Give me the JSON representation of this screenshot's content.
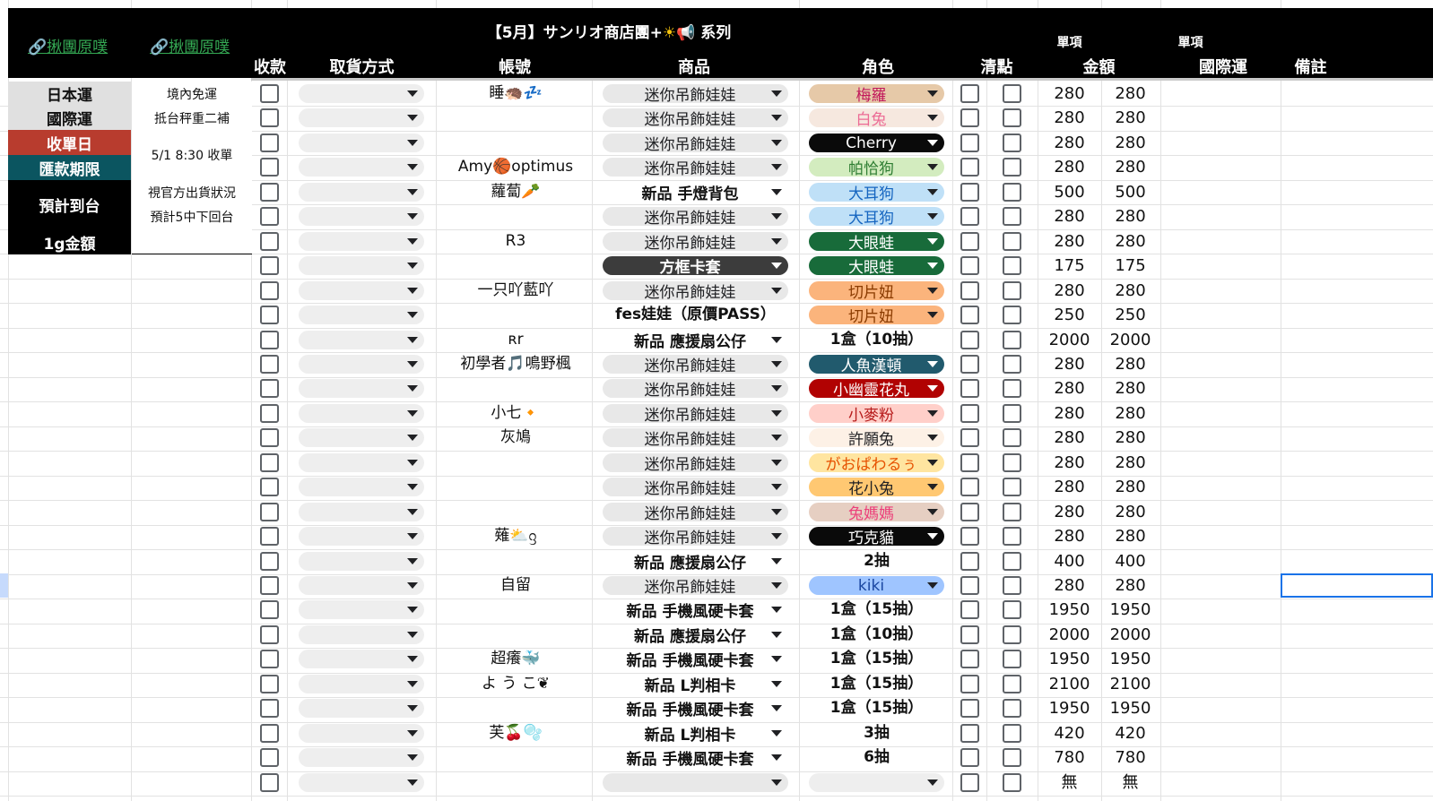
{
  "header": {
    "link1": "🔗揪團原噗",
    "link2": "🔗揪團原噗",
    "title": {
      "text1": "【5月】サンリオ商店團+",
      "sun": "☀",
      "horn": "📢",
      "text2": "系列"
    },
    "sub_single1": "單項",
    "sub_single2": "單項",
    "col_payment": "收款",
    "col_pickup": "取貨方式",
    "col_account": "帳號",
    "col_product": "商品",
    "col_role": "角色",
    "col_check": "清點",
    "col_amount": "金額",
    "col_intl": "國際運",
    "col_note": "備註"
  },
  "info": {
    "japan_ship": {
      "label": "日本運",
      "value": "境內免運"
    },
    "intl_ship": {
      "label": "國際運",
      "value": "抵台秤重二補"
    },
    "close_date": {
      "label": "收單日",
      "value": "5/1 8:30 收單"
    },
    "pay_deadline": {
      "label": "匯款期限"
    },
    "eta": {
      "label": "預計到台",
      "value1": "視官方出貨狀況",
      "value2": "預計5中下回台"
    },
    "per_gram": {
      "label": "1g金額",
      "value": ""
    }
  },
  "colors": {
    "header_bg": "#000000",
    "link": "#34a853",
    "close_date_bg": "#b83c2e",
    "deadline_bg": "#0b5560",
    "selection": "#1a73e8"
  },
  "rows": [
    {
      "account": "睡🦔💤",
      "product": "迷你吊飾娃娃",
      "pstyle": "gray",
      "role": "梅羅",
      "rbg": "#e6c9a8",
      "rfg": "#c2185b",
      "amount": "280",
      "intl": "280"
    },
    {
      "account": "",
      "product": "迷你吊飾娃娃",
      "pstyle": "gray",
      "role": "白兔",
      "rbg": "#f6e8df",
      "rfg": "#ec6b95",
      "amount": "280",
      "intl": "280"
    },
    {
      "account": "",
      "product": "迷你吊飾娃娃",
      "pstyle": "gray",
      "role": "Cherry",
      "rbg": "#0a0a0a",
      "rfg": "#ffffff",
      "amount": "280",
      "intl": "280"
    },
    {
      "account": "Amy🏀optimus",
      "product": "迷你吊飾娃娃",
      "pstyle": "gray",
      "role": "帕恰狗",
      "rbg": "#d3ecbf",
      "rfg": "#2e7d32",
      "amount": "280",
      "intl": "280"
    },
    {
      "account": "蘿蔔🥕",
      "product": "新品 手燈背包",
      "pstyle": "white",
      "role": "大耳狗",
      "rbg": "#bfe0f7",
      "rfg": "#1565c0",
      "amount": "500",
      "intl": "500"
    },
    {
      "account": "",
      "product": "迷你吊飾娃娃",
      "pstyle": "gray",
      "role": "大耳狗",
      "rbg": "#bfe0f7",
      "rfg": "#1565c0",
      "amount": "280",
      "intl": "280"
    },
    {
      "account": "R3",
      "product": "迷你吊飾娃娃",
      "pstyle": "gray",
      "role": "大眼蛙",
      "rbg": "#186b3a",
      "rfg": "#ffffff",
      "amount": "280",
      "intl": "280"
    },
    {
      "account": "",
      "product": "方框卡套",
      "pstyle": "dark",
      "role": "大眼蛙",
      "rbg": "#186b3a",
      "rfg": "#ffffff",
      "amount": "175",
      "intl": "175"
    },
    {
      "account": "一只吖藍吖",
      "product": "迷你吊飾娃娃",
      "pstyle": "gray",
      "role": "切片妞",
      "rbg": "#fbb47c",
      "rfg": "#8a3b00",
      "amount": "280",
      "intl": "280"
    },
    {
      "account": "",
      "product": "fes娃娃（原價PASS）",
      "pstyle": "text",
      "role": "切片妞",
      "rbg": "#fbb47c",
      "rfg": "#8a3b00",
      "amount": "250",
      "intl": "250"
    },
    {
      "account": "ʀr",
      "product": "新品 應援扇公仔",
      "pstyle": "white",
      "role": "1盒（10抽）",
      "rbg": "",
      "rfg": "#111111",
      "amount": "2000",
      "intl": "2000"
    },
    {
      "account": "初學者🎵鳴野楓",
      "product": "迷你吊飾娃娃",
      "pstyle": "gray",
      "role": "人魚漢頓",
      "rbg": "#215a6d",
      "rfg": "#ffffff",
      "amount": "280",
      "intl": "280"
    },
    {
      "account": "",
      "product": "迷你吊飾娃娃",
      "pstyle": "gray",
      "role": "小幽靈花丸",
      "rbg": "#b10202",
      "rfg": "#ffffff",
      "amount": "280",
      "intl": "280"
    },
    {
      "account": "小七🔸",
      "product": "迷你吊飾娃娃",
      "pstyle": "gray",
      "role": "小麥粉",
      "rbg": "#ffcfc9",
      "rfg": "#b71c1c",
      "amount": "280",
      "intl": "280"
    },
    {
      "account": "灰鳩",
      "product": "迷你吊飾娃娃",
      "pstyle": "gray",
      "role": "許願兔",
      "rbg": "#fdf1e6",
      "rfg": "#202124",
      "amount": "280",
      "intl": "280"
    },
    {
      "account": "",
      "product": "迷你吊飾娃娃",
      "pstyle": "gray",
      "role": "がおぱわるぅ",
      "rbg": "#ffe5a0",
      "rfg": "#e65100",
      "amount": "280",
      "intl": "280"
    },
    {
      "account": "",
      "product": "迷你吊飾娃娃",
      "pstyle": "gray",
      "role": "花小兔",
      "rbg": "#ffc872",
      "rfg": "#202124",
      "amount": "280",
      "intl": "280"
    },
    {
      "account": "",
      "product": "迷你吊飾娃娃",
      "pstyle": "gray",
      "role": "兔媽媽",
      "rbg": "#e6cfc2",
      "rfg": "#ec407a",
      "amount": "280",
      "intl": "280"
    },
    {
      "account": "薙⛅ᦋ",
      "product": "迷你吊飾娃娃",
      "pstyle": "gray",
      "role": "巧克貓",
      "rbg": "#0a0a0a",
      "rfg": "#ffffff",
      "amount": "280",
      "intl": "280"
    },
    {
      "account": "",
      "product": "新品 應援扇公仔",
      "pstyle": "white",
      "role": "2抽",
      "rbg": "",
      "rfg": "#111111",
      "amount": "400",
      "intl": "400"
    },
    {
      "account": "自留",
      "product": "迷你吊飾娃娃",
      "pstyle": "gray",
      "role": "kiki",
      "rbg": "#9fc5ff",
      "rfg": "#1a47a0",
      "amount": "280",
      "intl": "280"
    },
    {
      "account": "",
      "product": "新品 手機風硬卡套",
      "pstyle": "white",
      "role": "1盒（15抽）",
      "rbg": "",
      "rfg": "#111111",
      "amount": "1950",
      "intl": "1950"
    },
    {
      "account": "",
      "product": "新品 應援扇公仔",
      "pstyle": "white",
      "role": "1盒（10抽）",
      "rbg": "",
      "rfg": "#111111",
      "amount": "2000",
      "intl": "2000"
    },
    {
      "account": "超癢🐳",
      "product": "新品 手機風硬卡套",
      "pstyle": "white",
      "role": "1盒（15抽）",
      "rbg": "",
      "rfg": "#111111",
      "amount": "1950",
      "intl": "1950"
    },
    {
      "account": "よ う こ❦",
      "product": "新品 L判相卡",
      "pstyle": "white",
      "role": "1盒（15抽）",
      "rbg": "",
      "rfg": "#111111",
      "amount": "2100",
      "intl": "2100"
    },
    {
      "account": "",
      "product": "新品 手機風硬卡套",
      "pstyle": "white",
      "role": "1盒（15抽）",
      "rbg": "",
      "rfg": "#111111",
      "amount": "1950",
      "intl": "1950"
    },
    {
      "account": "芙🍒🫧",
      "product": "新品 L判相卡",
      "pstyle": "white",
      "role": "3抽",
      "rbg": "",
      "rfg": "#111111",
      "amount": "420",
      "intl": "420"
    },
    {
      "account": "",
      "product": "新品 手機風硬卡套",
      "pstyle": "white",
      "role": "6抽",
      "rbg": "",
      "rfg": "#111111",
      "amount": "780",
      "intl": "780"
    },
    {
      "account": "",
      "product": "",
      "pstyle": "gray",
      "role": "",
      "rbg": "#eeeeee",
      "rfg": "#111111",
      "amount": "無",
      "intl": "無"
    }
  ]
}
